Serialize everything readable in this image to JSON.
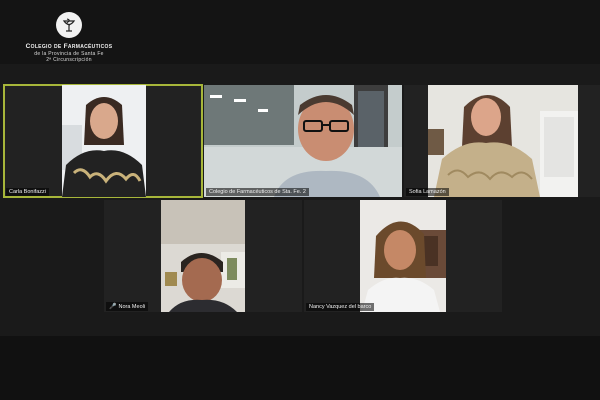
{
  "header": {
    "logo_icon": "caduceus-cup-icon",
    "org_line1": "Colegio de Farmacéuticos",
    "org_line2": "de la Provincia de Santa Fe",
    "org_line3": "2ª Circunscripción"
  },
  "participants": [
    {
      "name": "Carla Bonifazzi",
      "muted": false,
      "active": true
    },
    {
      "name": "Colegio de Farmacéuticos de Sta. Fe. 2",
      "muted": false,
      "active": false
    },
    {
      "name": "Sofia Lamazón",
      "muted": false,
      "active": false
    },
    {
      "name": "Nora Meoli",
      "muted": true,
      "active": false
    },
    {
      "name": "Nancy Vazquez del barco",
      "muted": false,
      "active": false
    }
  ],
  "colors": {
    "active_border": "#a7b63a",
    "mute_icon": "#e74c3c",
    "background": "#1a1a1a"
  }
}
